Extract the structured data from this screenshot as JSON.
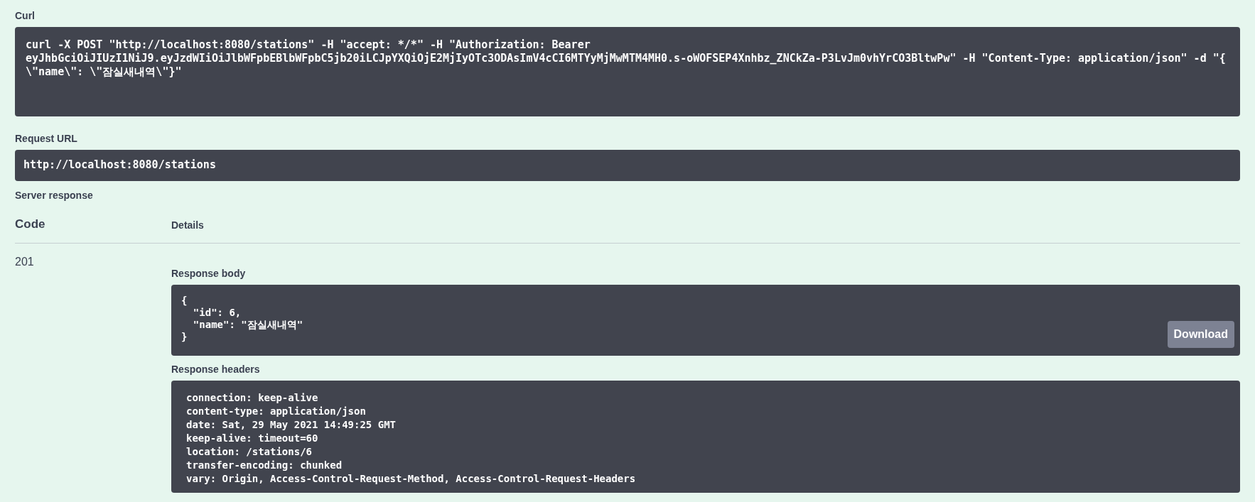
{
  "curl": {
    "label": "Curl",
    "command": "curl -X POST \"http://localhost:8080/stations\" -H \"accept: */*\" -H \"Authorization: Bearer eyJhbGciOiJIUzI1NiJ9.eyJzdWIiOiJlbWFpbEBlbWFpbC5jb20iLCJpYXQiOjE2MjIyOTc3ODAsImV4cCI6MTYyMjMwMTM4MH0.s-oWOFSEP4Xnhbz_ZNCkZa-P3LvJm0vhYrCO3BltwPw\" -H \"Content-Type: application/json\" -d \"{ \\\"name\\\": \\\"잠실새내역\\\"}\""
  },
  "request_url": {
    "label": "Request URL",
    "value": "http://localhost:8080/stations"
  },
  "server_response": {
    "label": "Server response",
    "columns": [
      "Code",
      "Details"
    ],
    "code": "201",
    "body": {
      "label": "Response body",
      "lines": [
        "{",
        "  \"id\": 6,",
        "  \"name\": \"잠실새내역\"",
        "}"
      ],
      "button": "Download"
    },
    "headers": {
      "label": "Response headers",
      "lines": [
        "connection: keep-alive",
        "content-type: application/json",
        "date: Sat, 29 May 2021 14:49:25 GMT",
        "keep-alive: timeout=60",
        "location: /stations/6",
        "transfer-encoding: chunked",
        "vary: Origin, Access-Control-Request-Method, Access-Control-Request-Headers"
      ]
    }
  }
}
